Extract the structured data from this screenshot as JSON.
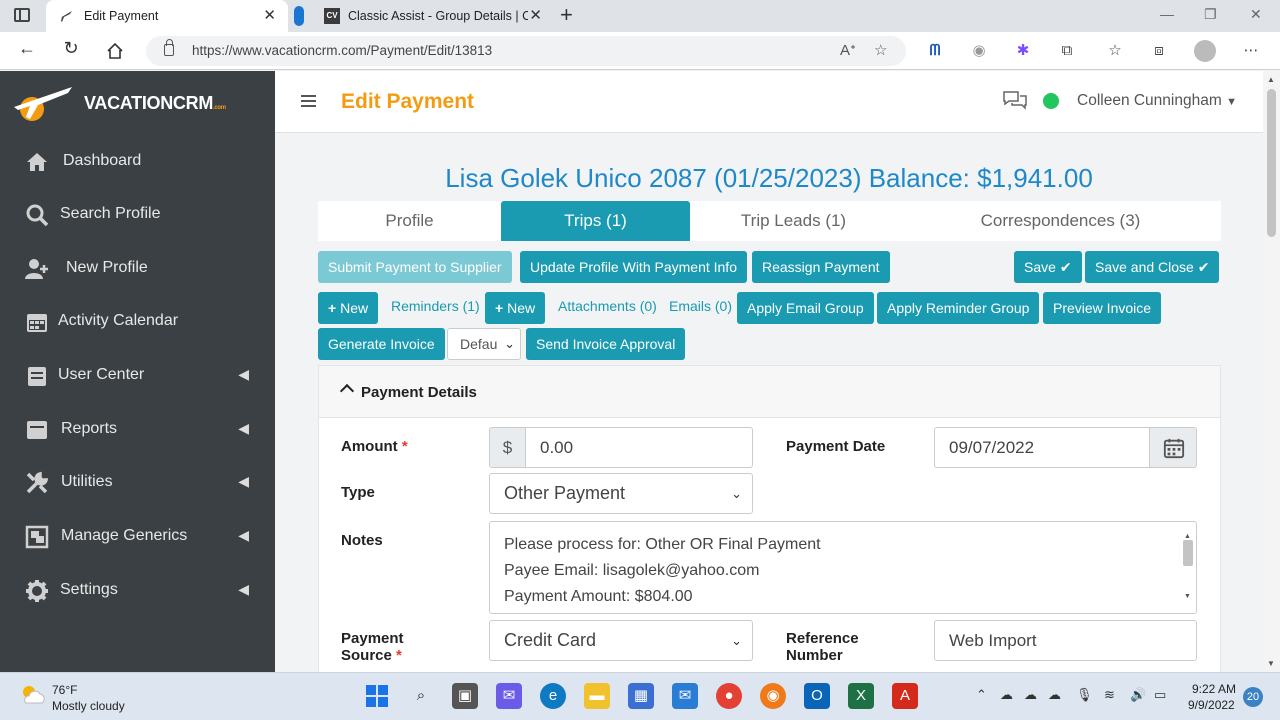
{
  "browser": {
    "tabs": [
      {
        "title": "Edit Payment",
        "active": true
      },
      {
        "title": "Classic Assist - Group Details | Cl",
        "active": false
      }
    ],
    "url": "https://www.vacationcrm.com/Payment/Edit/13813"
  },
  "brand": {
    "name": "VACATIONCRM",
    "suffix": ".com",
    "accent": "#f39c12"
  },
  "sidebar": {
    "items": [
      {
        "label": "Dashboard",
        "icon": "home-icon",
        "has_submenu": false
      },
      {
        "label": "Search Profile",
        "icon": "search-icon",
        "has_submenu": false
      },
      {
        "label": "New Profile",
        "icon": "user-plus-icon",
        "has_submenu": false
      },
      {
        "label": "Activity Calendar",
        "icon": "calendar-icon",
        "has_submenu": false
      },
      {
        "label": "User Center",
        "icon": "id-card-icon",
        "has_submenu": true
      },
      {
        "label": "Reports",
        "icon": "inbox-icon",
        "has_submenu": true
      },
      {
        "label": "Utilities",
        "icon": "tools-icon",
        "has_submenu": true
      },
      {
        "label": "Manage Generics",
        "icon": "object-group-icon",
        "has_submenu": true
      },
      {
        "label": "Settings",
        "icon": "gear-icon",
        "has_submenu": true
      }
    ]
  },
  "header": {
    "title": "Edit Payment",
    "user": "Colleen Cunningham",
    "status_color": "#22c55e"
  },
  "record": {
    "headline": "Lisa Golek Unico 2087 (01/25/2023) Balance: $1,941.00"
  },
  "tabs": [
    "Profile",
    "Trips (1)",
    "Trip Leads (1)",
    "Correspondences (3)"
  ],
  "toolbar": {
    "submit_supplier": "Submit Payment to Supplier",
    "update_profile": "Update Profile With Payment Info",
    "reassign": "Reassign Payment",
    "save": "Save",
    "save_close": "Save and Close",
    "new1": "New",
    "reminders": "Reminders (1)",
    "new2": "New",
    "attachments": "Attachments (0)",
    "emails": "Emails (0)",
    "apply_email_group": "Apply Email Group",
    "apply_reminder_group": "Apply Reminder Group",
    "preview_invoice": "Preview Invoice",
    "generate_invoice": "Generate Invoice",
    "template_select": "Defau",
    "send_invoice_approval": "Send Invoice Approval"
  },
  "panel": {
    "title": "Payment Details",
    "amount_label": "Amount",
    "amount_prefix": "$",
    "amount_value": "0.00",
    "payment_date_label": "Payment Date",
    "payment_date_value": "09/07/2022",
    "type_label": "Type",
    "type_value": "Other Payment",
    "notes_label": "Notes",
    "notes_lines": [
      "Please process for: Other OR Final Payment",
      "Payee Email: lisagolek@yahoo.com",
      "Payment Amount: $804.00"
    ],
    "payment_source_label_1": "Payment",
    "payment_source_label_2": "Source",
    "payment_source_value": "Credit Card",
    "reference_label_1": "Reference",
    "reference_label_2": "Number",
    "reference_value": "Web Import"
  },
  "taskbar": {
    "temp": "76°F",
    "weather": "Mostly cloudy",
    "time": "9:22 AM",
    "date": "9/9/2022",
    "notifications": "20"
  }
}
